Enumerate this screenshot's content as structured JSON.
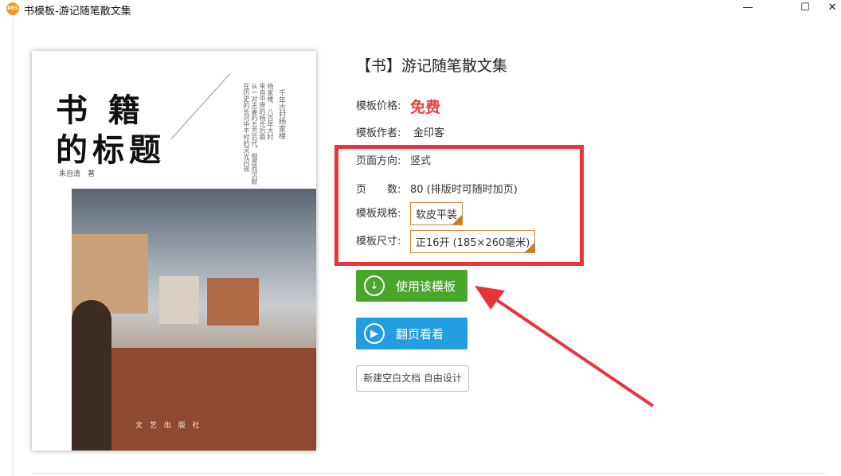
{
  "window": {
    "title": "书模板-游记随笔散文集",
    "logo": "DES",
    "minimize": "—",
    "maximize": "☐",
    "close": "✕"
  },
  "cover": {
    "title_line1": "书 籍",
    "title_line2": "的标题",
    "author": "朱自清　著",
    "vertical_title": "千年古村杨家楼",
    "vertical_text": [
      "杨家楼，八百年大村",
      "来自中原的杨氏后裔",
      "从一对夫妻的五方后代，倔厚而沉默",
      "在历史的长河中不时的灵光闪现"
    ],
    "publisher": "文 艺 出 版 社"
  },
  "detail": {
    "title": "【书】游记随笔散文集",
    "price_label": "模板价格:",
    "price": "免费",
    "author_label": "模板作者:",
    "author": "金印客",
    "orientation_label": "页面方向:",
    "orientation": "竖式",
    "pages_label": "页　　数:",
    "pages": "80 (排版时可随时加页)",
    "spec_label": "模板规格:",
    "spec": "软皮平装",
    "size_label": "模板尺寸:",
    "size": "正16开 (185×260毫米)"
  },
  "buttons": {
    "use": "使用该模板",
    "flip": "翻页看看",
    "new_doc": "新建空白文档 自由设计"
  },
  "colors": {
    "highlight": "#e8333a",
    "green": "#4aa62a",
    "blue": "#229ee0",
    "price": "#e6433c"
  }
}
